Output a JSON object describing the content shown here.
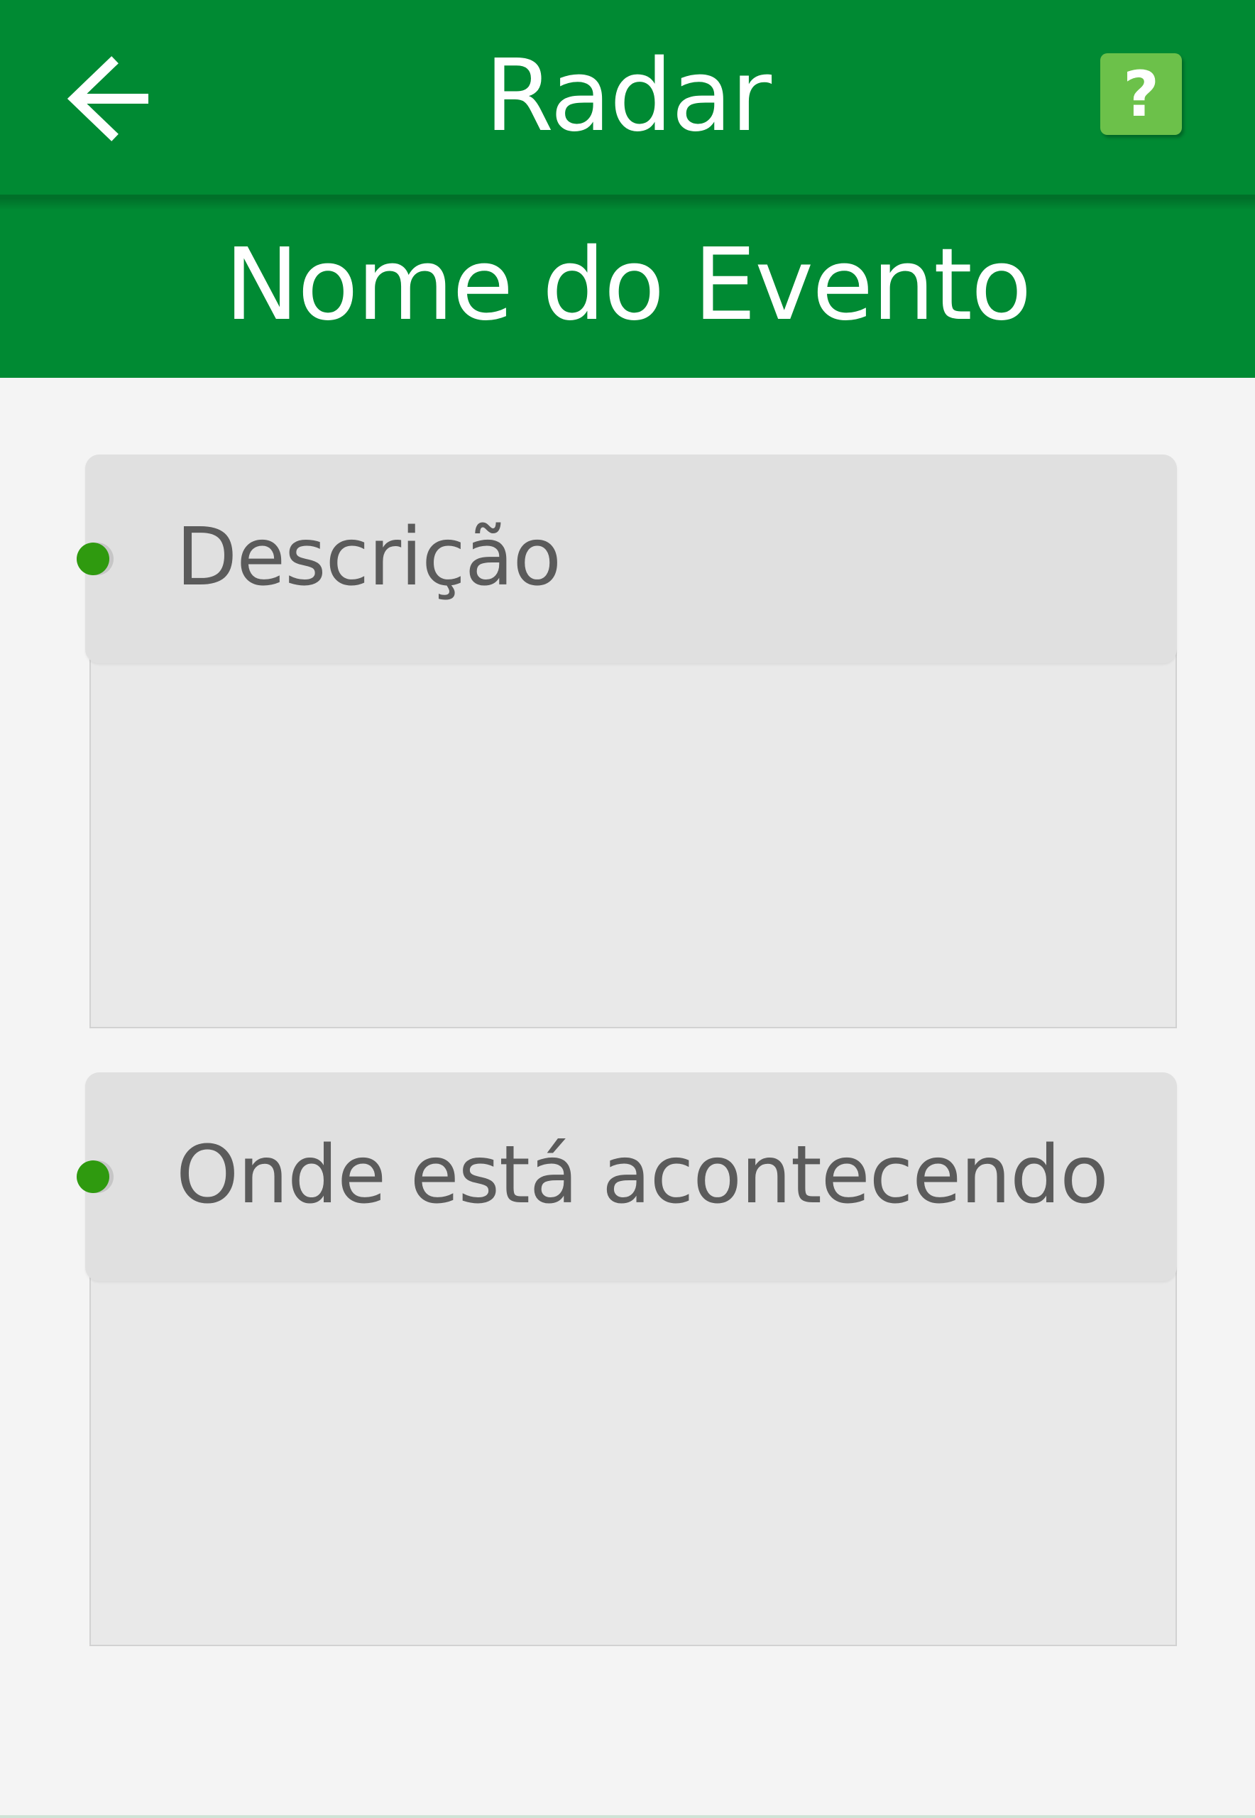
{
  "header": {
    "title": "Radar",
    "back_icon": "arrow-left-icon",
    "help_label": "?",
    "colors": {
      "bar": "#008a33",
      "help_button": "#6cc14a"
    }
  },
  "event": {
    "name": "Nome do Evento"
  },
  "sections": [
    {
      "label": "Descrição",
      "content": ""
    },
    {
      "label": "Onde está acontecendo",
      "content": ""
    }
  ],
  "colors": {
    "background": "#f4f4f4",
    "section_header": "#e0e0e0",
    "section_body": "#e9e9e9",
    "bullet": "#2f9a0f",
    "label_text": "#5b5b5b"
  }
}
